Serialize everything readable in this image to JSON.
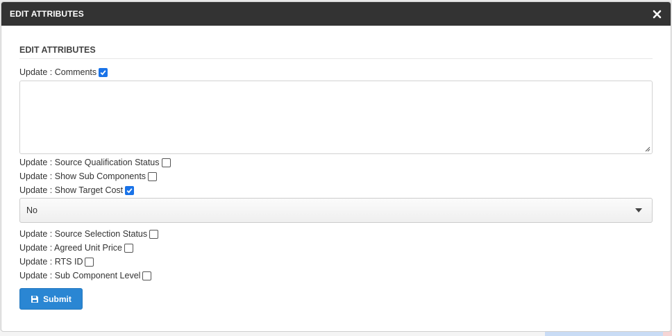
{
  "header": {
    "title": "EDIT ATTRIBUTES"
  },
  "section": {
    "title": "EDIT ATTRIBUTES"
  },
  "fields": {
    "comments": {
      "label": "Update : Comments",
      "checked": true
    },
    "comments_text": {
      "value": ""
    },
    "source_qualification_status": {
      "label": "Update : Source Qualification Status",
      "checked": false
    },
    "show_sub_components": {
      "label": "Update : Show Sub Components",
      "checked": false
    },
    "show_target_cost": {
      "label": "Update : Show Target Cost",
      "checked": true
    },
    "target_cost_select": {
      "value": "No"
    },
    "source_selection_status": {
      "label": "Update : Source Selection Status",
      "checked": false
    },
    "agreed_unit_price": {
      "label": "Update : Agreed Unit Price",
      "checked": false
    },
    "rts_id": {
      "label": "Update : RTS ID",
      "checked": false
    },
    "sub_component_level": {
      "label": "Update : Sub Component Level",
      "checked": false
    }
  },
  "actions": {
    "submit_label": "Submit"
  },
  "colors": {
    "header_bg": "#333333",
    "accent": "#2a86d3",
    "checkbox_checked": "#1a73e8"
  },
  "icons": {
    "close": "close-icon",
    "save": "floppy-disk-icon"
  }
}
